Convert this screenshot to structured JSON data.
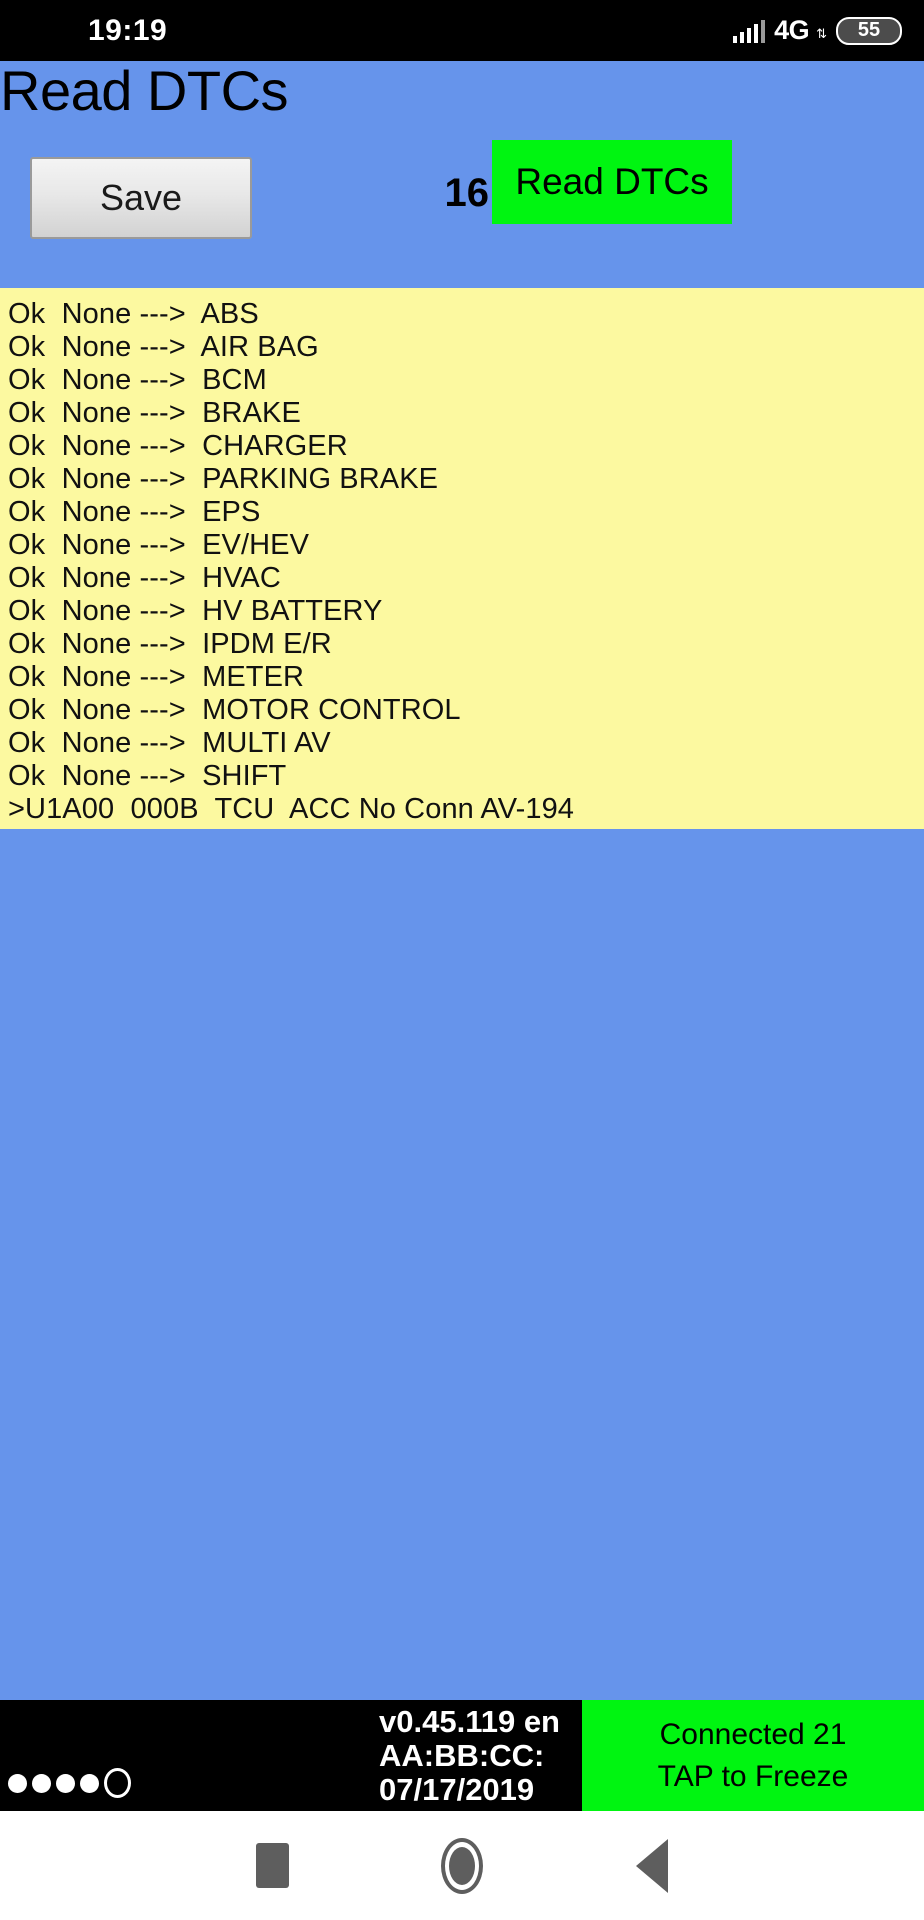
{
  "status_bar": {
    "time": "19:19",
    "network_type": "4G",
    "network_arrows": "⇅",
    "battery_level": "55",
    "signal_icon": "signal-bars-icon"
  },
  "app_header": {
    "title": "Read DTCs",
    "save_label": "Save",
    "dtc_count": "16",
    "read_dtcs_label": "Read DTCs",
    "background_color": "#6694eb",
    "read_button_color": "#00f511"
  },
  "dtc_list": {
    "background_color": "#fcf9a0",
    "rows": [
      {
        "text": "Ok  None --->  ABS"
      },
      {
        "text": "Ok  None --->  AIR BAG"
      },
      {
        "text": "Ok  None --->  BCM"
      },
      {
        "text": "Ok  None --->  BRAKE"
      },
      {
        "text": "Ok  None --->  CHARGER"
      },
      {
        "text": "Ok  None --->  PARKING BRAKE"
      },
      {
        "text": "Ok  None --->  EPS"
      },
      {
        "text": "Ok  None --->  EV/HEV"
      },
      {
        "text": "Ok  None --->  HVAC"
      },
      {
        "text": "Ok  None --->  HV BATTERY"
      },
      {
        "text": "Ok  None --->  IPDM E/R"
      },
      {
        "text": "Ok  None --->  METER"
      },
      {
        "text": "Ok  None --->  MOTOR CONTROL"
      },
      {
        "text": "Ok  None --->  MULTI AV"
      },
      {
        "text": "Ok  None --->  SHIFT"
      },
      {
        "text": ">U1A00  000B  TCU  ACC No Conn AV-194"
      }
    ]
  },
  "bottom_bar": {
    "page_dots": {
      "filled": 4,
      "hollow": 1
    },
    "version": "v0.45.119 en",
    "adapter_id": "AA:BB:CC:",
    "date": "07/17/2019",
    "connection_status": "Connected 21",
    "freeze_hint": "TAP to Freeze",
    "status_color": "#00f511"
  },
  "nav_bar": {
    "recents_icon": "square-icon",
    "home_icon": "circle-icon",
    "back_icon": "triangle-left-icon"
  }
}
